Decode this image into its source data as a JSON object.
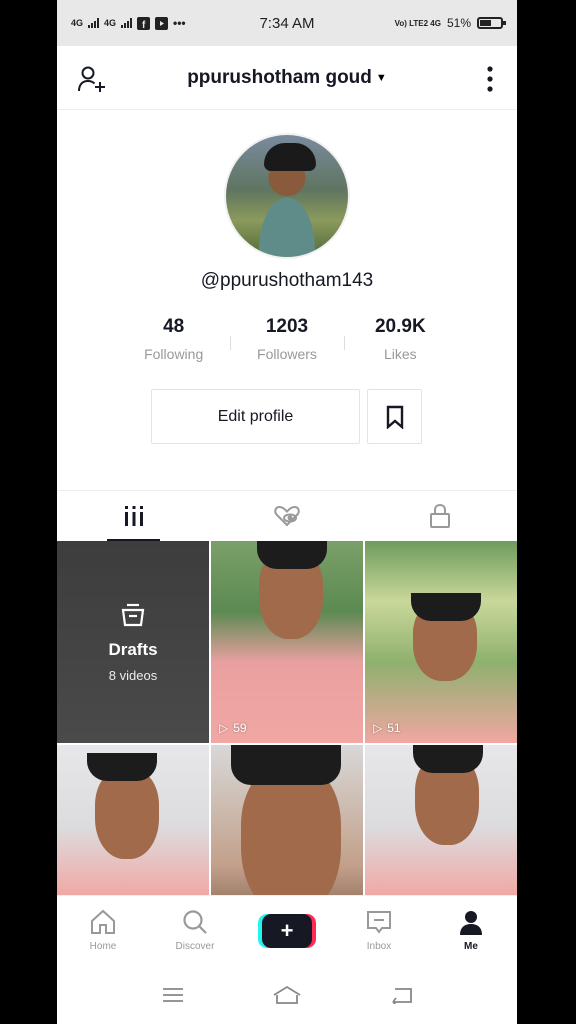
{
  "status": {
    "time": "7:34 AM",
    "signal1": "4G",
    "signal2": "4G",
    "network": "Vo) LTE2 4G",
    "battery": "51%",
    "battery_level": 0.51
  },
  "header": {
    "username": "ppurushotham goud"
  },
  "profile": {
    "handle": "@ppurushotham143"
  },
  "stats": [
    {
      "value": "48",
      "label": "Following"
    },
    {
      "value": "1203",
      "label": "Followers"
    },
    {
      "value": "20.9K",
      "label": "Likes"
    }
  ],
  "buttons": {
    "edit_profile": "Edit profile"
  },
  "drafts": {
    "title": "Drafts",
    "subtitle": "8 videos"
  },
  "videos": [
    {
      "plays": "59"
    },
    {
      "plays": "51"
    }
  ],
  "nav": {
    "home": "Home",
    "discover": "Discover",
    "inbox": "Inbox",
    "me": "Me"
  }
}
